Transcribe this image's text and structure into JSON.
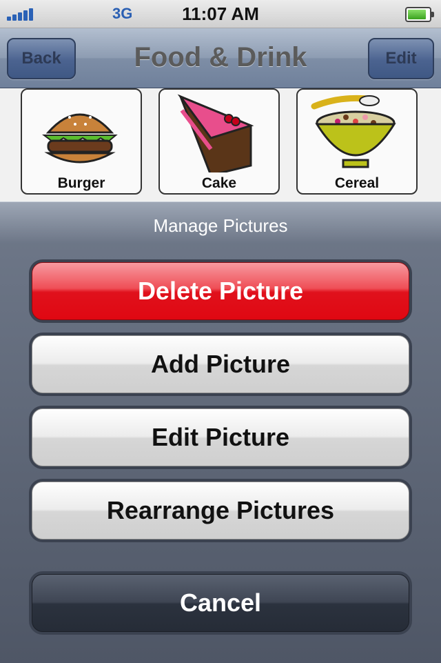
{
  "status_bar": {
    "carrier_network": "3G",
    "time": "11:07 AM"
  },
  "nav": {
    "title": "Food & Drink",
    "back_label": "Back",
    "edit_label": "Edit"
  },
  "grid": {
    "tiles": [
      {
        "label": "Burger",
        "icon": "burger-icon"
      },
      {
        "label": "Cake",
        "icon": "cake-icon"
      },
      {
        "label": "Cereal",
        "icon": "cereal-icon"
      }
    ]
  },
  "action_sheet": {
    "title": "Manage Pictures",
    "buttons": {
      "delete": "Delete Picture",
      "add": "Add Picture",
      "edit": "Edit Picture",
      "rearrange": "Rearrange Pictures",
      "cancel": "Cancel"
    }
  },
  "colors": {
    "destructive": "#e00812",
    "nav_tint": "#7e8ea6",
    "signal": "#2a61b6",
    "battery": "#3aa21e"
  }
}
